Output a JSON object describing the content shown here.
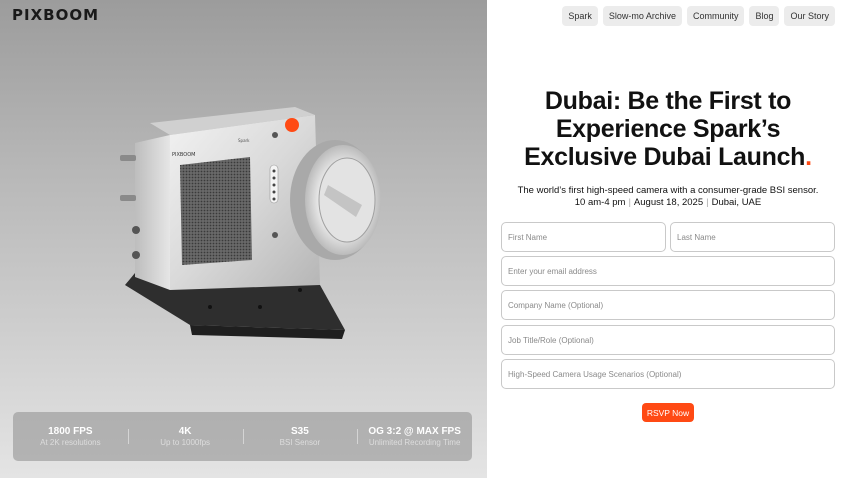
{
  "brand": {
    "logo": "PIXBOOM"
  },
  "nav": {
    "items": [
      {
        "label": "Spark"
      },
      {
        "label": "Slow-mo Archive"
      },
      {
        "label": "Community"
      },
      {
        "label": "Blog"
      },
      {
        "label": "Our Story"
      }
    ]
  },
  "hero": {
    "camera_brand": "PIXBOOM",
    "camera_model": "Spark",
    "specs": [
      {
        "value": "1800 FPS",
        "sub": "At 2K resolutions"
      },
      {
        "value": "4K",
        "sub": "Up to 1000fps"
      },
      {
        "value": "S35",
        "sub": "BSI Sensor"
      },
      {
        "value": "OG 3:2 @ MAX FPS",
        "sub": "Unlimited Recording Time"
      }
    ]
  },
  "main": {
    "headline_line1": "Dubai: Be the First to",
    "headline_line2": "Experience Spark’s",
    "headline_line3": "Exclusive Dubai Launch",
    "headline_dot": ".",
    "subline": "The world’s first high-speed camera with a consumer-grade BSI sensor.",
    "time": "10 am-4 pm",
    "date": "August 18,  2025",
    "location": "Dubai, UAE",
    "sep": "|"
  },
  "form": {
    "first_name_placeholder": "First Name",
    "last_name_placeholder": "Last Name",
    "email_placeholder": "Enter your email address",
    "company_placeholder": "Company Name (Optional)",
    "job_placeholder": "Job Title/Role (Optional)",
    "usage_placeholder": "High-Speed Camera Usage Scenarios (Optional)",
    "submit_label": "RSVP Now"
  },
  "colors": {
    "accent": "#ff4a14"
  }
}
